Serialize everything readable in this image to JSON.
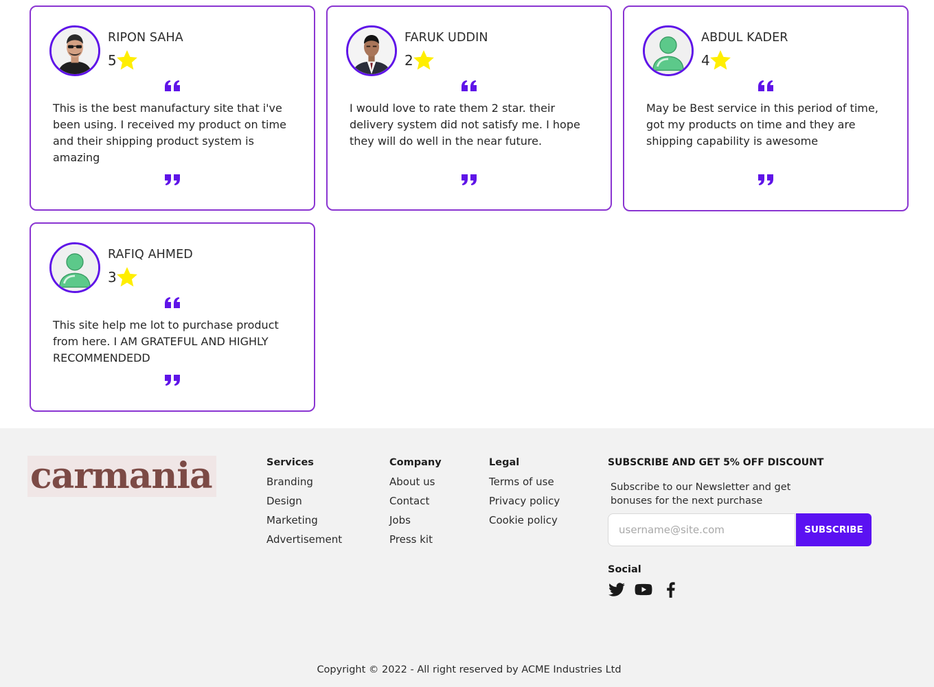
{
  "reviews": [
    {
      "name": "RIPON SAHA",
      "rating": "5",
      "text": "This is the best manufactury site that i've been using. I received my product on time and their shipping product system is amazing",
      "avatar": "man-sunglasses-photo"
    },
    {
      "name": "FARUK UDDIN",
      "rating": "2",
      "text": "I would love to rate them 2 star. their delivery system did not satisfy me. I hope they will do well in the near future.",
      "avatar": "man-suit-photo"
    },
    {
      "name": "ABDUL KADER",
      "rating": "4",
      "text": "May be Best service in this period of time, got my products on time and they are shipping capability is awesome",
      "avatar": "default-user-icon"
    },
    {
      "name": "RAFIQ AHMED",
      "rating": "3",
      "text": "This site help me lot to purchase product from here. I AM GRATEFUL AND HIGHLY RECOMMENDEDD",
      "avatar": "default-user-icon"
    }
  ],
  "footer": {
    "logo": "carmania",
    "services": {
      "title": "Services",
      "links": [
        "Branding",
        "Design",
        "Marketing",
        "Advertisement"
      ]
    },
    "company": {
      "title": "Company",
      "links": [
        "About us",
        "Contact",
        "Jobs",
        "Press kit"
      ]
    },
    "legal": {
      "title": "Legal",
      "links": [
        "Terms of use",
        "Privacy policy",
        "Cookie policy"
      ]
    },
    "subscribe": {
      "title": "SUBSCRIBE AND GET 5% OFF DISCOUNT",
      "description": "Subscribe to our Newsletter and get bonuses for the next purchase",
      "placeholder": "username@site.com",
      "button": "SUBSCRIBE"
    },
    "social": {
      "title": "Social",
      "icons": [
        "twitter-icon",
        "youtube-icon",
        "facebook-icon"
      ]
    },
    "copyright": "Copyright © 2022 - All right reserved by ACME Industries Ltd"
  },
  "colors": {
    "accent": "#5b12f2",
    "card_border": "#8a35d1",
    "star": "#ffee00",
    "logo": "#7c4a45",
    "footer_bg": "#f2f2f2"
  }
}
